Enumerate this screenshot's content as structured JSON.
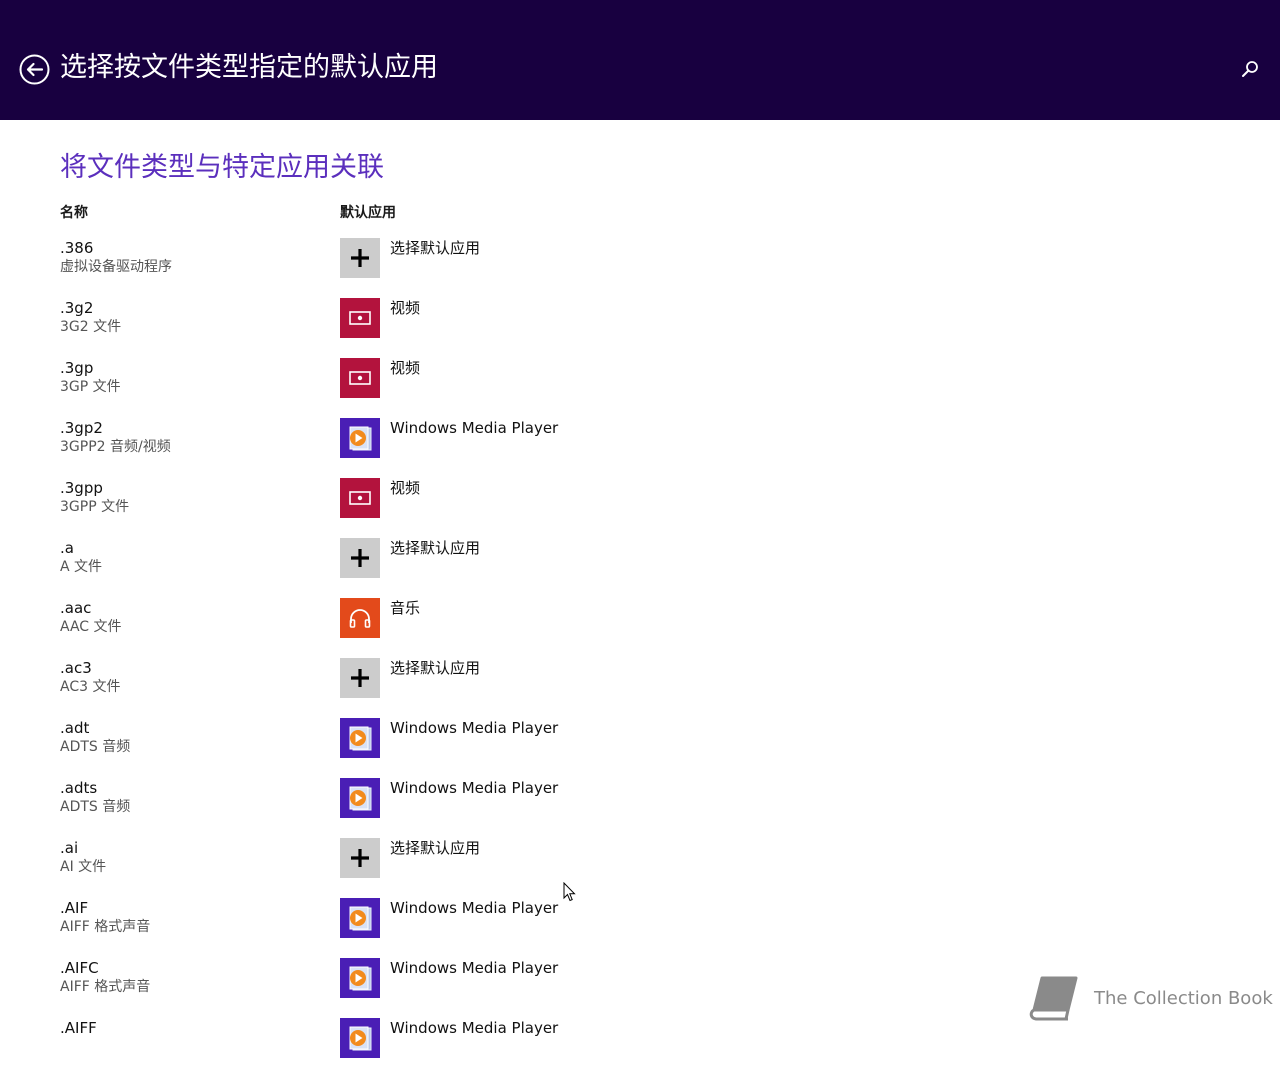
{
  "header": {
    "title": "选择按文件类型指定的默认应用"
  },
  "section_title": "将文件类型与特定应用关联",
  "columns": {
    "name": "名称",
    "default_app": "默认应用"
  },
  "rows": [
    {
      "ext": ".386",
      "desc": "虚拟设备驱动程序",
      "app": "选择默认应用",
      "app_icon": "plus-icon"
    },
    {
      "ext": ".3g2",
      "desc": "3G2 文件",
      "app": "视频",
      "app_icon": "video-icon"
    },
    {
      "ext": ".3gp",
      "desc": "3GP 文件",
      "app": "视频",
      "app_icon": "video-icon"
    },
    {
      "ext": ".3gp2",
      "desc": "3GPP2 音频/视频",
      "app": "Windows Media Player",
      "app_icon": "media-player-icon"
    },
    {
      "ext": ".3gpp",
      "desc": "3GPP 文件",
      "app": "视频",
      "app_icon": "video-icon"
    },
    {
      "ext": ".a",
      "desc": "A 文件",
      "app": "选择默认应用",
      "app_icon": "plus-icon"
    },
    {
      "ext": ".aac",
      "desc": "AAC 文件",
      "app": "音乐",
      "app_icon": "headphones-icon"
    },
    {
      "ext": ".ac3",
      "desc": "AC3 文件",
      "app": "选择默认应用",
      "app_icon": "plus-icon"
    },
    {
      "ext": ".adt",
      "desc": "ADTS 音频",
      "app": "Windows Media Player",
      "app_icon": "media-player-icon"
    },
    {
      "ext": ".adts",
      "desc": "ADTS 音频",
      "app": "Windows Media Player",
      "app_icon": "media-player-icon"
    },
    {
      "ext": ".ai",
      "desc": "AI 文件",
      "app": "选择默认应用",
      "app_icon": "plus-icon"
    },
    {
      "ext": ".AIF",
      "desc": "AIFF 格式声音",
      "app": "Windows Media Player",
      "app_icon": "media-player-icon"
    },
    {
      "ext": ".AIFC",
      "desc": "AIFF 格式声音",
      "app": "Windows Media Player",
      "app_icon": "media-player-icon"
    },
    {
      "ext": ".AIFF",
      "desc": "",
      "app": "Windows Media Player",
      "app_icon": "media-player-icon"
    }
  ],
  "watermark": {
    "text": "The Collection Book"
  },
  "colors": {
    "header_bg": "#180040",
    "section_title": "#5b2fbd",
    "video_tile": "#b3133d",
    "music_tile": "#e34a1b",
    "wmp_tile": "#4a1eb5",
    "plus_tile": "#cccccc"
  }
}
